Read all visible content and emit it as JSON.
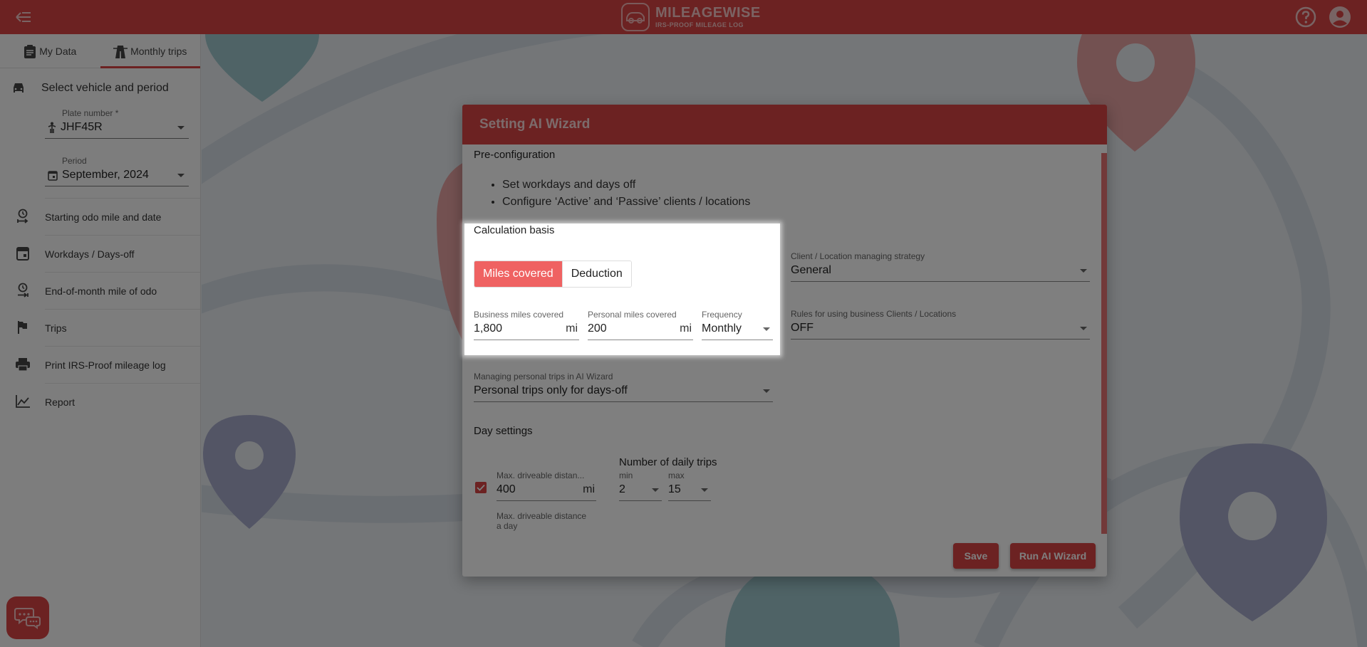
{
  "topbar": {
    "menu_icon": "menu-collapse-icon",
    "logo_title": "MILEAGEWISE",
    "logo_subtitle": "IRS-PROOF MILEAGE LOG",
    "help_icon": "help-circle-icon",
    "account_icon": "account-circle-icon"
  },
  "sidebar": {
    "tabs": [
      {
        "label": "My Data",
        "icon": "clipboard-icon",
        "active": false
      },
      {
        "label": "Monthly trips",
        "icon": "highway-icon",
        "active": true
      }
    ],
    "section_title": "Select vehicle and period",
    "plate_field": {
      "label": "Plate number *",
      "value": "JHF45R"
    },
    "period_field": {
      "label": "Period",
      "value": "September, 2024"
    },
    "nav_items": [
      {
        "label": "Starting odo mile and date",
        "icon": "clock-start-icon"
      },
      {
        "label": "Workdays / Days-off",
        "icon": "calendar-icon"
      },
      {
        "label": "End-of-month mile of odo",
        "icon": "clock-end-icon"
      },
      {
        "label": "Trips",
        "icon": "flag-icon"
      },
      {
        "label": "Print IRS-Proof mileage log",
        "icon": "printer-icon"
      },
      {
        "label": "Report",
        "icon": "chart-line-icon"
      }
    ],
    "chat_icon": "chat-bubbles-icon"
  },
  "dialog": {
    "title": "Setting AI Wizard",
    "preconfig": {
      "title": "Pre-configuration",
      "bullets": [
        "Set workdays and days off",
        "Configure ‘Active’ and ‘Passive’ clients / locations"
      ]
    },
    "calc_basis": {
      "title": "Calculation basis",
      "options": [
        "Miles covered",
        "Deduction"
      ],
      "selected": "Miles covered",
      "business_miles": {
        "label": "Business miles covered",
        "value": "1,800",
        "unit": "mi"
      },
      "personal_miles": {
        "label": "Personal miles covered",
        "value": "200",
        "unit": "mi"
      },
      "frequency": {
        "label": "Frequency",
        "value": "Monthly"
      }
    },
    "client_strategy": {
      "label": "Client / Location managing strategy",
      "value": "General"
    },
    "business_rules": {
      "label": "Rules for using business Clients / Locations",
      "value": "OFF"
    },
    "personal_trips": {
      "label": "Managing personal trips in AI Wizard",
      "value": "Personal trips only for days-off"
    },
    "day_settings": {
      "title": "Day settings",
      "max_distance": {
        "label": "Max. driveable distan...",
        "value": "400",
        "unit": "mi",
        "helper_line1": "Max. driveable distance",
        "helper_line2": "a day",
        "checked": true
      },
      "daily_trips_title": "Number of daily trips",
      "min": {
        "label": "min",
        "value": "2"
      },
      "max": {
        "label": "max",
        "value": "15"
      }
    },
    "buttons": {
      "save": "Save",
      "run": "Run AI Wizard"
    }
  },
  "colors": {
    "brand": "#d84545",
    "toggle_active": "#ef6262"
  }
}
